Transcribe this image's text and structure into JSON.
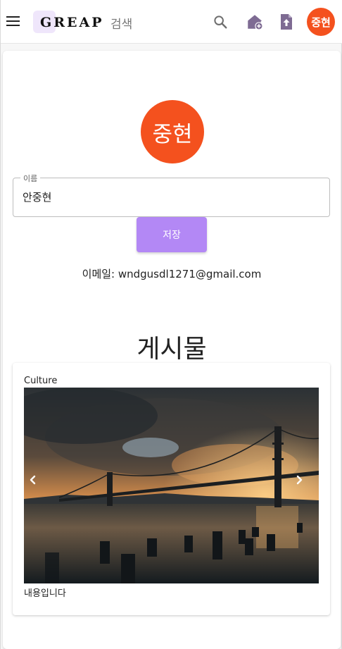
{
  "header": {
    "logo_text": "GREAP",
    "search_label": "검색",
    "avatar_initials": "중현",
    "accent_color": "#f4511e",
    "icons": [
      "menu-icon",
      "search-icon",
      "add-home-icon",
      "upload-file-icon"
    ]
  },
  "profile": {
    "avatar_initials": "중현",
    "name_label": "이름",
    "name_value": "안중현",
    "save_label": "저장",
    "email_text": "이메일: wndgusdl1271@gmail.com"
  },
  "posts_section": {
    "title": "게시물",
    "posts": [
      {
        "category": "Culture",
        "body": "내용입니다"
      }
    ]
  }
}
